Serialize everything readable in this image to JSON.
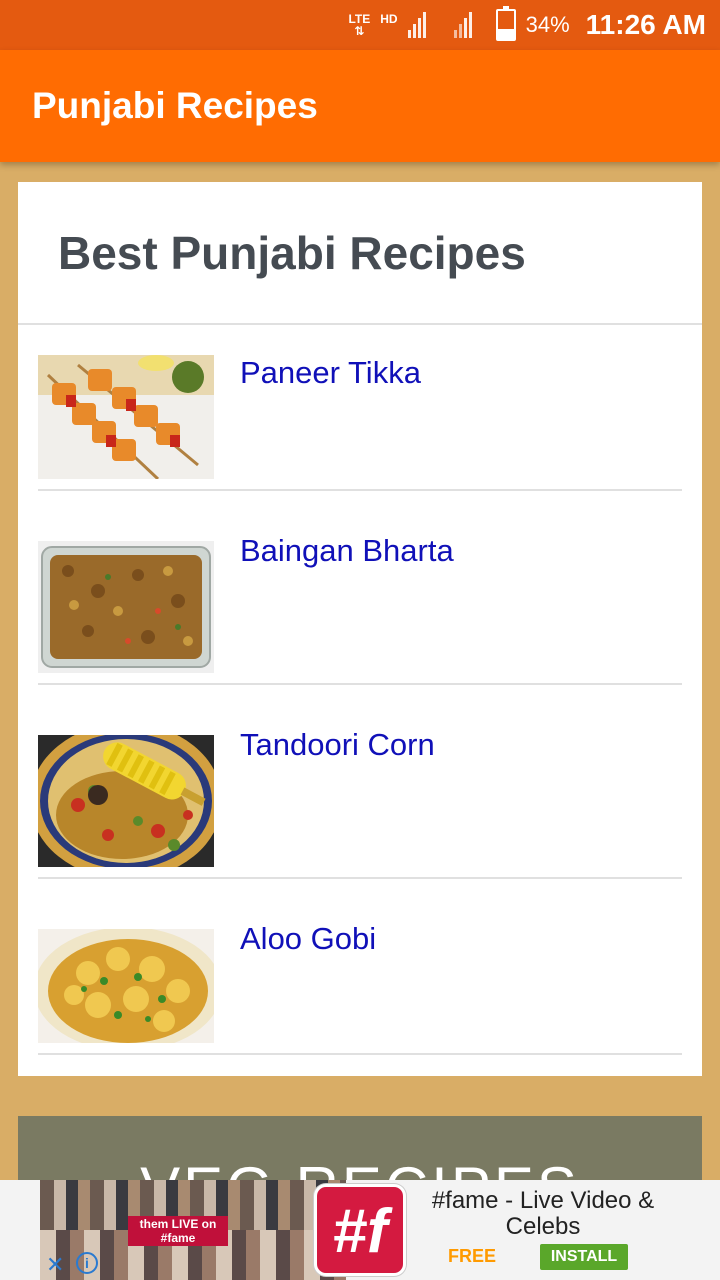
{
  "status_bar": {
    "network_type": "LTE",
    "hd_label": "HD",
    "battery": "34%",
    "time": "11:26 AM"
  },
  "app_bar": {
    "title": "Punjabi Recipes"
  },
  "card": {
    "title": "Best Punjabi Recipes",
    "items": [
      {
        "label": "Paneer Tikka",
        "image": "paneer-tikka-image"
      },
      {
        "label": "Baingan Bharta",
        "image": "baingan-bharta-image"
      },
      {
        "label": "Tandoori Corn",
        "image": "tandoori-corn-image"
      },
      {
        "label": "Aloo Gobi",
        "image": "aloo-gobi-image"
      }
    ]
  },
  "veg_banner": {
    "title": "VEG RECIPES"
  },
  "ad": {
    "promo_text": "them LIVE on #fame",
    "logo_text": "#f",
    "title": "#fame - Live Video & Celebs",
    "price": "FREE",
    "install_label": "INSTALL",
    "close_icon": "close-icon",
    "info_icon": "info-icon"
  },
  "colors": {
    "status_bar": "#e45a10",
    "app_bar": "#ff6c02",
    "background": "#d9ad66",
    "link": "#1010b8",
    "veg_banner": "#7a7a62",
    "install_button": "#5aa72a"
  }
}
